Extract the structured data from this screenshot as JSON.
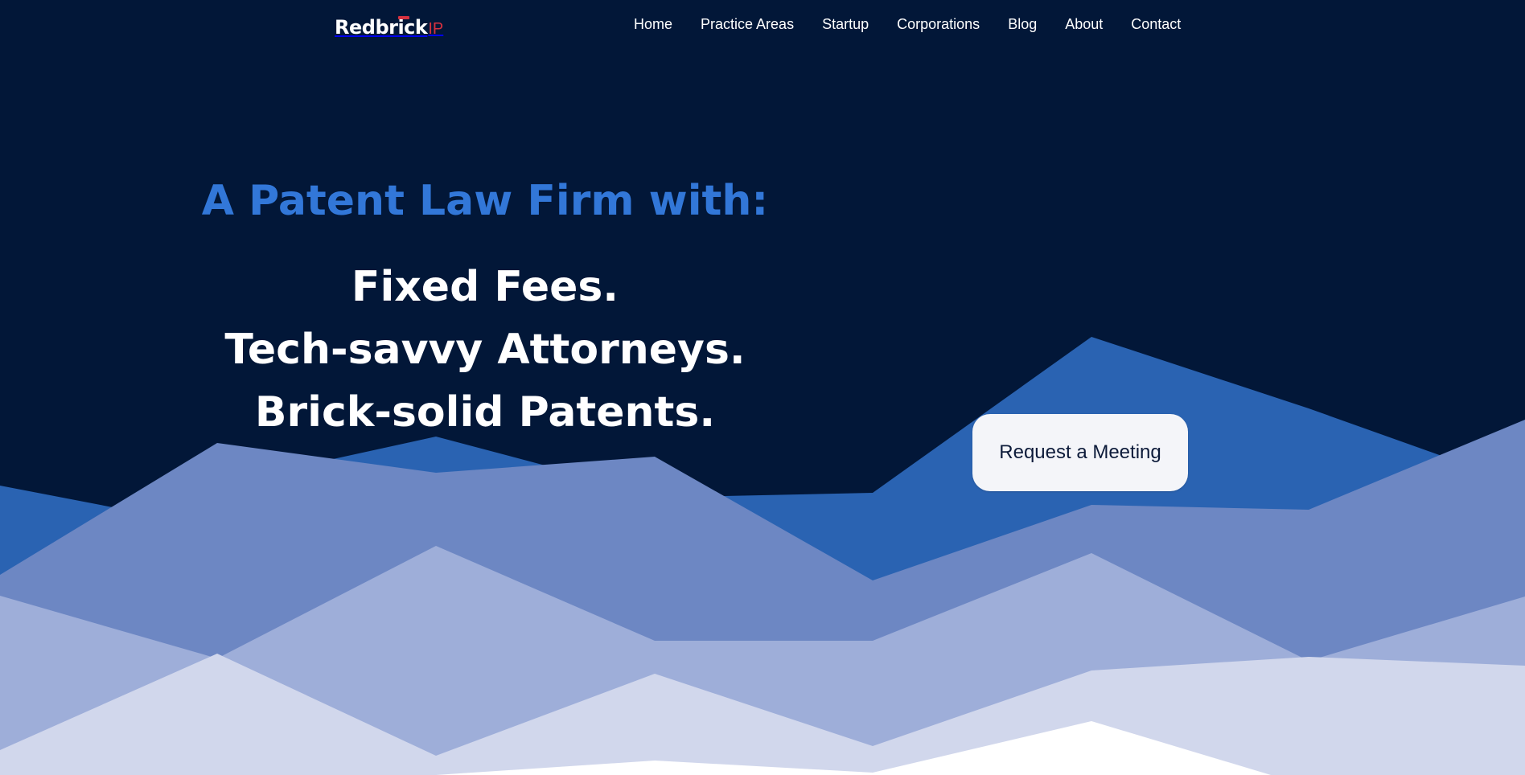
{
  "brand": {
    "name": "Redbrick",
    "suffix": "IP"
  },
  "nav": {
    "items": [
      "Home",
      "Practice Areas",
      "Startup",
      "Corporations",
      "Blog",
      "About",
      "Contact"
    ]
  },
  "hero": {
    "subtitle": "A Patent Law Firm with:",
    "lines": [
      "Fixed Fees.",
      "Tech-savvy Attorneys.",
      "Brick-solid Patents."
    ],
    "cta_label": "Request a Meeting"
  },
  "colors": {
    "background": "#021738",
    "accent_blue": "#3277d8",
    "brand_red": "#d6313f",
    "mountain_1": "#2a63b2",
    "mountain_2": "#6d87c3",
    "mountain_3": "#9eaed9",
    "mountain_4": "#d1d7ec"
  }
}
